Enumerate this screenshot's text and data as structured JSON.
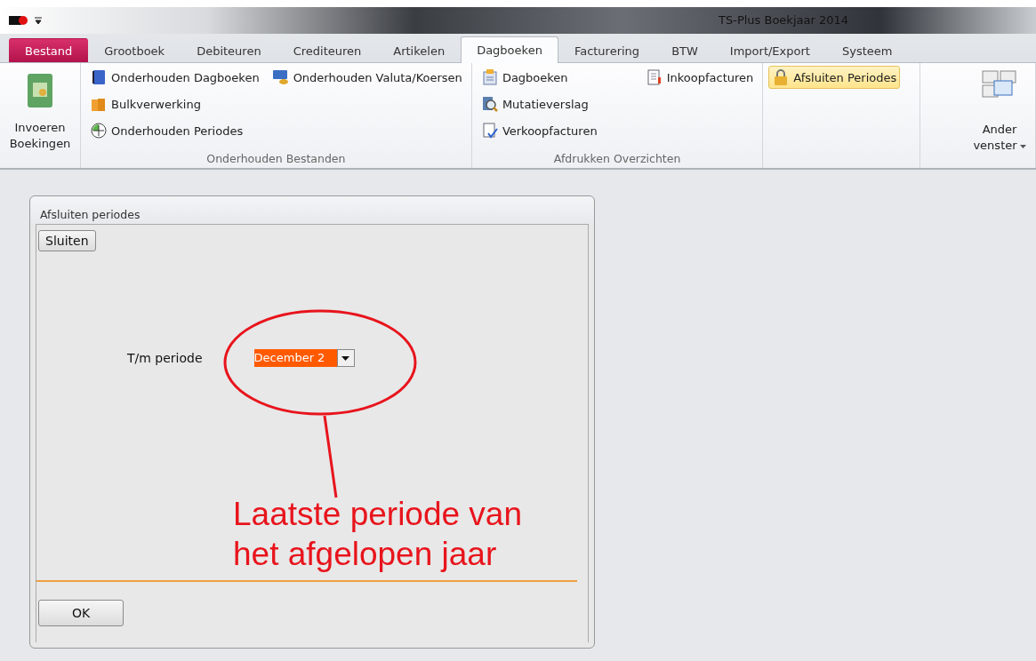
{
  "window": {
    "title": "TS-Plus Boekjaar 2014"
  },
  "tabs": [
    {
      "label": "Bestand",
      "kind": "file",
      "selected": false
    },
    {
      "label": "Grootboek",
      "kind": "tab",
      "selected": false
    },
    {
      "label": "Debiteuren",
      "kind": "tab",
      "selected": false
    },
    {
      "label": "Crediteuren",
      "kind": "tab",
      "selected": false
    },
    {
      "label": "Artikelen",
      "kind": "tab",
      "selected": false
    },
    {
      "label": "Dagboeken",
      "kind": "tab",
      "selected": true
    },
    {
      "label": "Facturering",
      "kind": "tab",
      "selected": false
    },
    {
      "label": "BTW",
      "kind": "tab",
      "selected": false
    },
    {
      "label": "Import/Export",
      "kind": "tab",
      "selected": false
    },
    {
      "label": "Systeem",
      "kind": "tab",
      "selected": false
    }
  ],
  "ribbon": [
    {
      "kind": "large",
      "label": [
        "Invoeren",
        "Boekingen"
      ],
      "dropdown": false
    },
    {
      "kind": "group",
      "label": "Onderhouden Bestanden",
      "columns": [
        [
          {
            "label": "Onderhouden Dagboeken",
            "active": false
          },
          {
            "label": "Bulkverwerking",
            "active": false
          },
          {
            "label": "Onderhouden Periodes",
            "active": false
          }
        ],
        [
          {
            "label": "Onderhouden Valuta/Koersen",
            "active": false
          }
        ]
      ]
    },
    {
      "kind": "group",
      "label": "Afdrukken Overzichten",
      "columns": [
        [
          {
            "label": "Dagboeken",
            "active": false
          },
          {
            "label": "Mutatieverslag",
            "active": false
          },
          {
            "label": "Verkoopfacturen",
            "active": false
          }
        ],
        [
          {
            "label": "Inkoopfacturen",
            "active": false
          }
        ]
      ]
    },
    {
      "kind": "group",
      "columns": [
        [
          {
            "label": "Afsluiten Periodes",
            "active": true
          }
        ]
      ]
    },
    {
      "kind": "large",
      "label": [
        "Ander",
        "venster"
      ],
      "dropdown": true
    }
  ],
  "dialog": {
    "title": "Afsluiten periodes",
    "close_button": "Sluiten",
    "field_label": "T/m periode",
    "period": {
      "value": "December 2",
      "selected": true
    },
    "ok_button": "OK"
  },
  "annotation": {
    "lines": [
      "Laatste periode van",
      "het afgelopen jaar"
    ]
  }
}
